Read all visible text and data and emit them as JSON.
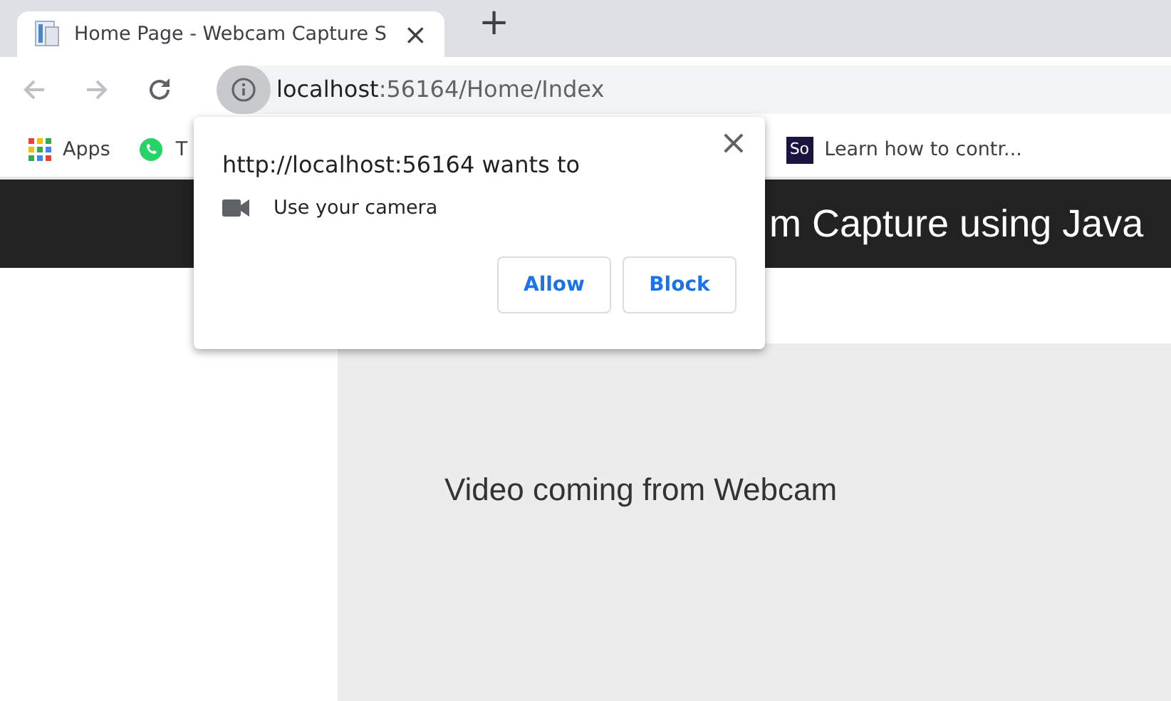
{
  "tab": {
    "title": "Home Page - Webcam Capture S",
    "close": "×"
  },
  "new_tab": "+",
  "address": {
    "host": "localhost",
    "rest": ":56164/Home/Index"
  },
  "bookmarks": [
    {
      "kind": "apps",
      "label": "Apps"
    },
    {
      "kind": "whatsapp",
      "label": "T"
    },
    {
      "kind": "so",
      "icon_text": "So",
      "label": "Learn how to contr..."
    }
  ],
  "page": {
    "header": "m Capture using Java",
    "video_text": "Video coming from Webcam"
  },
  "permission": {
    "title": "http://localhost:56164 wants to",
    "close": "×",
    "request": "Use your camera",
    "buttons": [
      "Allow",
      "Block"
    ]
  }
}
